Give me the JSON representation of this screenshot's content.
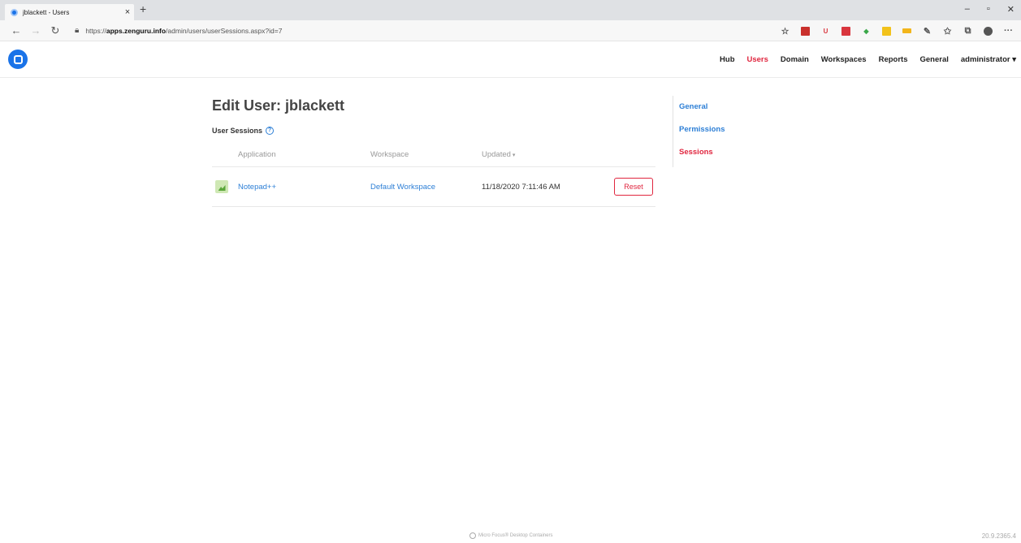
{
  "browser": {
    "tab_title": "jblackett - Users",
    "tab_close": "×",
    "new_tab": "+",
    "win_min": "–",
    "win_max": "▫",
    "win_close": "✕",
    "url_prefix": "https://",
    "url_host": "apps.zenguru.info",
    "url_path": "/admin/users/userSessions.aspx?id=7"
  },
  "header": {
    "nav": [
      "Hub",
      "Users",
      "Domain",
      "Workspaces",
      "Reports",
      "General",
      "administrator ▾"
    ],
    "active": "Users"
  },
  "page": {
    "title": "Edit User: jblackett",
    "section_label": "User Sessions",
    "help_glyph": "?"
  },
  "table": {
    "columns": [
      "Application",
      "Workspace",
      "Updated"
    ],
    "sort_indicator": "▾",
    "rows": [
      {
        "application": "Notepad++",
        "workspace": "Default Workspace",
        "updated": "11/18/2020 7:11:46 AM",
        "action": "Reset"
      }
    ]
  },
  "sidenav": {
    "items": [
      "General",
      "Permissions",
      "Sessions"
    ],
    "active": "Sessions"
  },
  "footer": {
    "text": "Micro Focus® Desktop Containers",
    "version": "20.9.2365.4"
  },
  "colors": {
    "accent": "#1a73e8",
    "link": "#2d7fd6",
    "active": "#e0263f"
  }
}
